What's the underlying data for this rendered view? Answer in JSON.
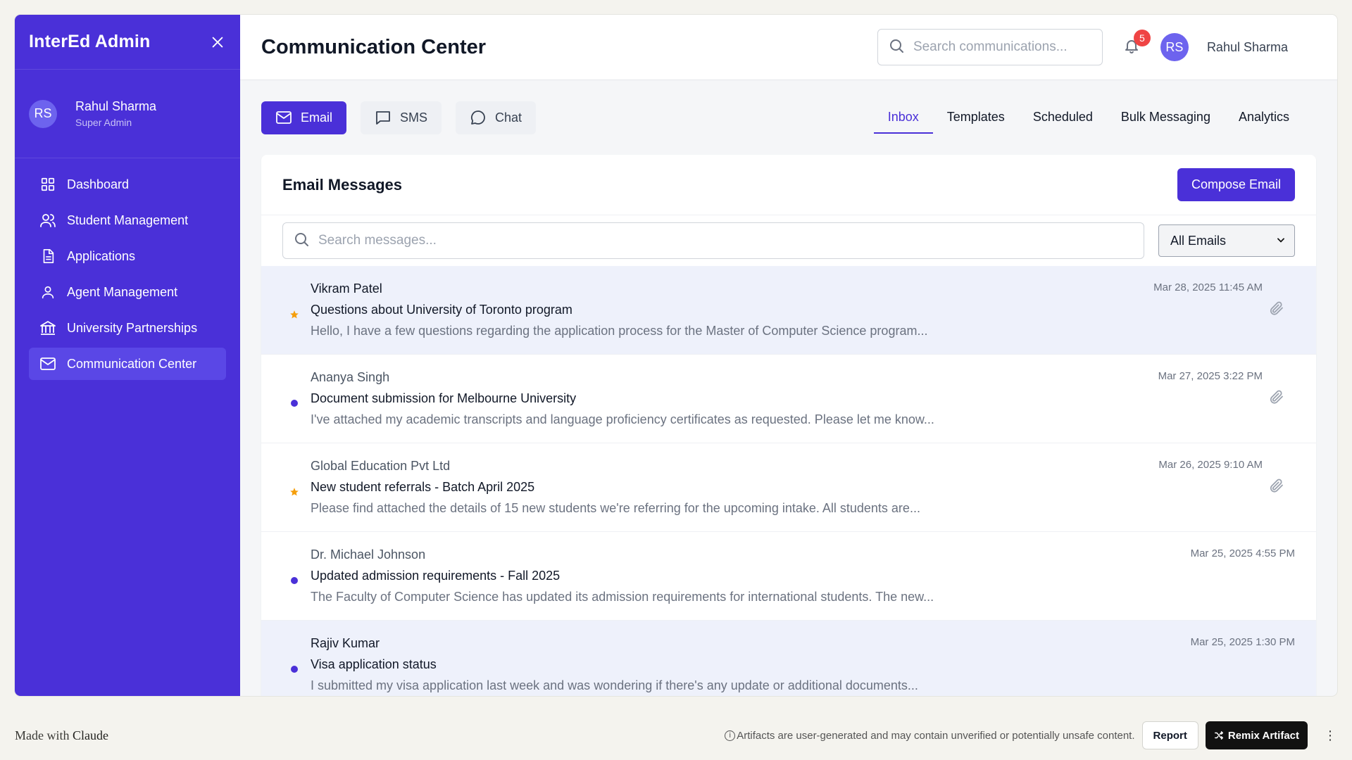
{
  "sidebar": {
    "title": "InterEd Admin",
    "user": {
      "initials": "RS",
      "name": "Rahul Sharma",
      "role": "Super Admin"
    },
    "items": [
      {
        "label": "Dashboard",
        "icon": "dashboard-icon"
      },
      {
        "label": "Student Management",
        "icon": "users-icon"
      },
      {
        "label": "Applications",
        "icon": "document-icon"
      },
      {
        "label": "Agent Management",
        "icon": "user-icon"
      },
      {
        "label": "University Partnerships",
        "icon": "building-icon"
      },
      {
        "label": "Communication Center",
        "icon": "mail-icon",
        "active": true
      }
    ]
  },
  "header": {
    "title": "Communication Center",
    "search_placeholder": "Search communications...",
    "notifications_count": "5",
    "user_initials": "RS",
    "user_name": "Rahul Sharma"
  },
  "channels": [
    {
      "label": "Email",
      "icon": "mail-icon",
      "active": true
    },
    {
      "label": "SMS",
      "icon": "message-square-icon"
    },
    {
      "label": "Chat",
      "icon": "chat-bubble-icon"
    }
  ],
  "subtabs": [
    {
      "label": "Inbox",
      "active": true
    },
    {
      "label": "Templates"
    },
    {
      "label": "Scheduled"
    },
    {
      "label": "Bulk Messaging"
    },
    {
      "label": "Analytics"
    }
  ],
  "messages_card": {
    "title": "Email Messages",
    "compose_label": "Compose Email",
    "search_placeholder": "Search messages...",
    "filter_value": "All Emails"
  },
  "messages": [
    {
      "sender": "Vikram Patel",
      "subject": "Questions about University of Toronto program",
      "preview": "Hello, I have a few questions regarding the application process for the Master of Computer Science program...",
      "date": "Mar 28, 2025 11:45 AM",
      "mark": "star",
      "attachment": true,
      "highlight": true,
      "read": false
    },
    {
      "sender": "Ananya Singh",
      "subject": "Document submission for Melbourne University",
      "preview": "I've attached my academic transcripts and language proficiency certificates as requested. Please let me know...",
      "date": "Mar 27, 2025 3:22 PM",
      "mark": "dot",
      "attachment": true,
      "highlight": false,
      "read": true
    },
    {
      "sender": "Global Education Pvt Ltd",
      "subject": "New student referrals - Batch April 2025",
      "preview": "Please find attached the details of 15 new students we're referring for the upcoming intake. All students are...",
      "date": "Mar 26, 2025 9:10 AM",
      "mark": "star",
      "attachment": true,
      "highlight": false,
      "read": true
    },
    {
      "sender": "Dr. Michael Johnson",
      "subject": "Updated admission requirements - Fall 2025",
      "preview": "The Faculty of Computer Science has updated its admission requirements for international students. The new...",
      "date": "Mar 25, 2025 4:55 PM",
      "mark": "dot",
      "attachment": false,
      "highlight": false,
      "read": true
    },
    {
      "sender": "Rajiv Kumar",
      "subject": "Visa application status",
      "preview": "I submitted my visa application last week and was wondering if there's any update or additional documents...",
      "date": "Mar 25, 2025 1:30 PM",
      "mark": "dot",
      "attachment": false,
      "highlight": true,
      "read": false
    }
  ],
  "footer": {
    "made_with": "Made with",
    "brand": "Claude",
    "notice": "Artifacts are user-generated and may contain unverified or potentially unsafe content.",
    "report_label": "Report",
    "remix_label": "Remix Artifact"
  },
  "colors": {
    "primary": "#4a30d8",
    "sidebar": "#4a30d8",
    "badge": "#ef4444",
    "star": "#f59e0b"
  }
}
